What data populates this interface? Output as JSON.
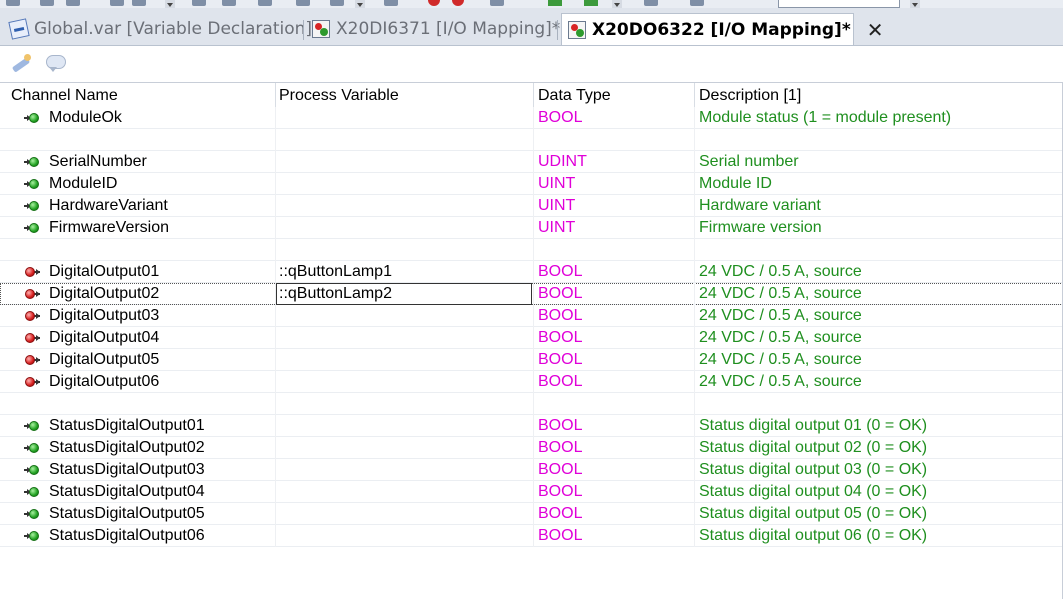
{
  "tabs": [
    {
      "label": "Global.var [Variable Declaration]",
      "icon": "variable-declaration-icon",
      "active": false
    },
    {
      "label": "X20DI6371 [I/O Mapping]*",
      "icon": "io-mapping-icon",
      "active": false
    },
    {
      "label": "X20DO6322 [I/O Mapping]*",
      "icon": "io-mapping-icon",
      "active": true
    }
  ],
  "tab_close_glyph": "✕",
  "toolbar": {
    "icons": [
      "insert-variable-icon",
      "comment-icon"
    ]
  },
  "columns": {
    "channel_name": "Channel Name",
    "process_variable": "Process Variable",
    "data_type": "Data Type",
    "description": "Description [1]"
  },
  "colors": {
    "data_type": "#e000d8",
    "description": "#1f8f1f",
    "input_pin": "#23a323",
    "output_pin": "#d81f1f"
  },
  "rows": [
    {
      "kind": "in",
      "name": "ModuleOk",
      "pv": "",
      "type": "BOOL",
      "desc": "Module status (1 = module present)"
    },
    {
      "kind": "blank"
    },
    {
      "kind": "in",
      "name": "SerialNumber",
      "pv": "",
      "type": "UDINT",
      "desc": "Serial number"
    },
    {
      "kind": "in",
      "name": "ModuleID",
      "pv": "",
      "type": "UINT",
      "desc": "Module ID"
    },
    {
      "kind": "in",
      "name": "HardwareVariant",
      "pv": "",
      "type": "UINT",
      "desc": "Hardware variant"
    },
    {
      "kind": "in",
      "name": "FirmwareVersion",
      "pv": "",
      "type": "UINT",
      "desc": "Firmware version"
    },
    {
      "kind": "blank"
    },
    {
      "kind": "out",
      "name": "DigitalOutput01",
      "pv": "::qButtonLamp1",
      "type": "BOOL",
      "desc": "24 VDC / 0.5 A, source"
    },
    {
      "kind": "out",
      "name": "DigitalOutput02",
      "pv": "::qButtonLamp2",
      "type": "BOOL",
      "desc": "24 VDC / 0.5 A, source",
      "selected": true
    },
    {
      "kind": "out",
      "name": "DigitalOutput03",
      "pv": "",
      "type": "BOOL",
      "desc": "24 VDC / 0.5 A, source"
    },
    {
      "kind": "out",
      "name": "DigitalOutput04",
      "pv": "",
      "type": "BOOL",
      "desc": "24 VDC / 0.5 A, source"
    },
    {
      "kind": "out",
      "name": "DigitalOutput05",
      "pv": "",
      "type": "BOOL",
      "desc": "24 VDC / 0.5 A, source"
    },
    {
      "kind": "out",
      "name": "DigitalOutput06",
      "pv": "",
      "type": "BOOL",
      "desc": "24 VDC / 0.5 A, source"
    },
    {
      "kind": "blank"
    },
    {
      "kind": "in",
      "name": "StatusDigitalOutput01",
      "pv": "",
      "type": "BOOL",
      "desc": "Status digital output 01 (0 = OK)"
    },
    {
      "kind": "in",
      "name": "StatusDigitalOutput02",
      "pv": "",
      "type": "BOOL",
      "desc": "Status digital output 02 (0 = OK)"
    },
    {
      "kind": "in",
      "name": "StatusDigitalOutput03",
      "pv": "",
      "type": "BOOL",
      "desc": "Status digital output 03 (0 = OK)"
    },
    {
      "kind": "in",
      "name": "StatusDigitalOutput04",
      "pv": "",
      "type": "BOOL",
      "desc": "Status digital output 04 (0 = OK)"
    },
    {
      "kind": "in",
      "name": "StatusDigitalOutput05",
      "pv": "",
      "type": "BOOL",
      "desc": "Status digital output 05 (0 = OK)"
    },
    {
      "kind": "in",
      "name": "StatusDigitalOutput06",
      "pv": "",
      "type": "BOOL",
      "desc": "Status digital output 06 (0 = OK)"
    }
  ]
}
